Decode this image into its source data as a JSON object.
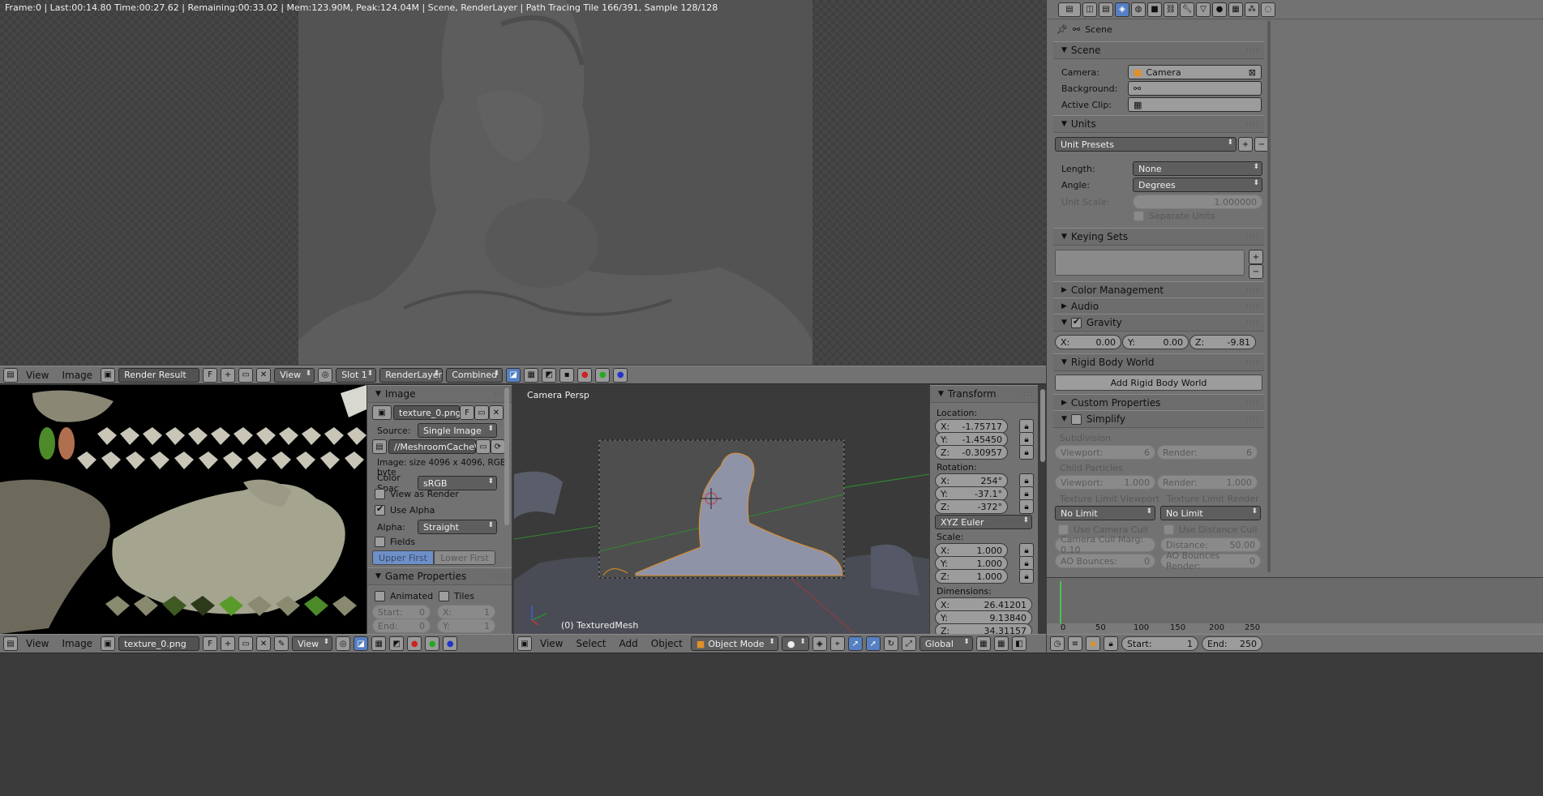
{
  "render_view": {
    "status": "Frame:0 | Last:00:14.80 Time:00:27.62 | Remaining:00:33.02 | Mem:123.90M, Peak:124.04M | Scene, RenderLayer | Path Tracing Tile 166/391, Sample 128/128"
  },
  "image_editor_header": {
    "menu_view": "View",
    "menu_image": "Image",
    "image_name": "Render Result",
    "fake_user": "F",
    "view_label": "View",
    "slot": "Slot 1",
    "layer": "RenderLayer",
    "pass": "Combined"
  },
  "image_panel": {
    "title": "Image",
    "image_name": "texture_0.png",
    "fake_user": "F",
    "source_label": "Source:",
    "source_value": "Single Image",
    "filepath": "//MeshroomCache\\Te...",
    "info": "Image: size 4096 x 4096, RGB byte",
    "color_space_label": "Color Spac",
    "color_space_value": "sRGB",
    "view_as_render": "View as Render",
    "use_alpha": "Use Alpha",
    "alpha_label": "Alpha:",
    "alpha_value": "Straight",
    "fields": "Fields",
    "upper_first": "Upper First",
    "lower_first": "Lower First",
    "game_props_title": "Game Properties",
    "animated": "Animated",
    "tiles": "Tiles",
    "start_label": "Start:",
    "start_value": "0",
    "end_label": "End:",
    "end_value": "0",
    "x_label": "X:",
    "x_value": "1",
    "y_label": "Y:",
    "y_value": "1"
  },
  "uv_header": {
    "menu_view": "View",
    "menu_image": "Image",
    "image_name": "texture_0.png",
    "fake_user": "F",
    "view_label": "View"
  },
  "viewport": {
    "label": "Camera Persp",
    "object_label": "(0) TexturedMesh",
    "menu_view": "View",
    "menu_select": "Select",
    "menu_add": "Add",
    "menu_object": "Object",
    "mode": "Object Mode",
    "orientation": "Global"
  },
  "transform": {
    "title": "Transform",
    "location_label": "Location:",
    "loc_x": "-1.75717",
    "loc_y": "-1.45450",
    "loc_z": "-0.30957",
    "rotation_label": "Rotation:",
    "rot_x": "254°",
    "rot_y": "-37.1°",
    "rot_z": "-372°",
    "rot_mode": "XYZ Euler",
    "scale_label": "Scale:",
    "scale_x": "1.000",
    "scale_y": "1.000",
    "scale_z": "1.000",
    "dimensions_label": "Dimensions:",
    "dim_x": "26.41201",
    "dim_y": "9.13840",
    "dim_z": "34.31157",
    "x_label": "X:",
    "y_label": "Y:",
    "z_label": "Z:"
  },
  "properties": {
    "breadcrumb": "Scene",
    "scene_panel": "Scene",
    "camera_label": "Camera:",
    "camera_value": "Camera",
    "background_label": "Background:",
    "active_clip_label": "Active Clip:",
    "units_panel": "Units",
    "unit_presets": "Unit Presets",
    "length_label": "Length:",
    "length_value": "None",
    "angle_label": "Angle:",
    "angle_value": "Degrees",
    "unit_scale_label": "Unit Scale:",
    "unit_scale_value": "1.000000",
    "separate_units": "Separate Units",
    "keying_sets_panel": "Keying Sets",
    "color_management_panel": "Color Management",
    "audio_panel": "Audio",
    "gravity_panel": "Gravity",
    "gravity_x": "0.00",
    "gravity_y": "0.00",
    "gravity_z": "-9.81",
    "x_label": "X:",
    "y_label": "Y:",
    "z_label": "Z:",
    "rigid_body_panel": "Rigid Body World",
    "add_rigid_body": "Add Rigid Body World",
    "custom_props_panel": "Custom Properties",
    "simplify_panel": "Simplify",
    "subdivision_label": "Subdivision",
    "viewport_label": "Viewport:",
    "viewport_subdiv": "6",
    "render_label": "Render:",
    "render_subdiv": "6",
    "child_particles_label": "Child Particles",
    "viewport_particles": "1.000",
    "render_particles": "1.000",
    "tex_limit_viewport_label": "Texture Limit Viewport",
    "tex_limit_render_label": "Texture Limit Render",
    "tex_limit_viewport": "No Limit",
    "tex_limit_render": "No Limit",
    "use_camera_cull": "Use Camera Cull",
    "use_distance_cull": "Use Distance Cull",
    "camera_cull_margin": "Camera Cull Marg: 0.10",
    "distance_label": "Distance:",
    "distance_value": "50.00",
    "ao_bounces_label": "AO Bounces:",
    "ao_bounces": "0",
    "ao_bounces_render_label": "AO Bounces Render:",
    "ao_bounces_render": "0"
  },
  "timeline": {
    "ticks": [
      "0",
      "50",
      "100",
      "150",
      "200",
      "250"
    ],
    "start_label": "Start:",
    "start_value": "1",
    "end_label": "End:",
    "end_value": "250"
  }
}
